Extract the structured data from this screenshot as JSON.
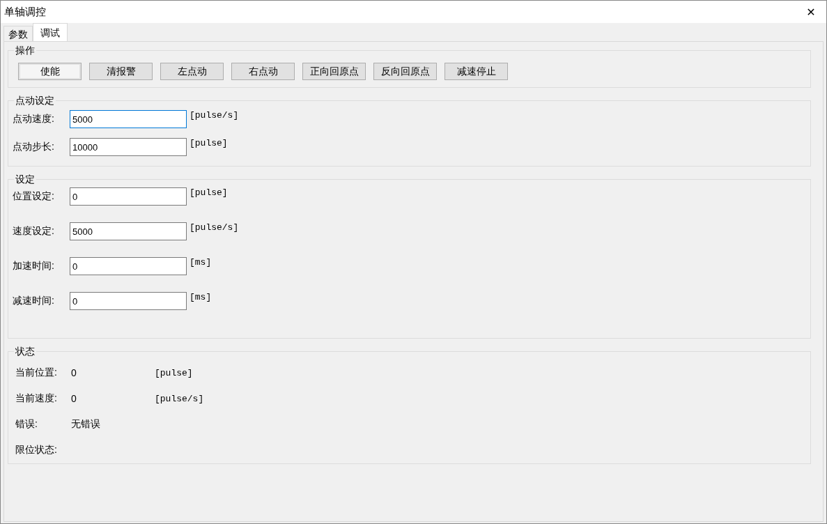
{
  "window": {
    "title": "单轴调控",
    "close": "✕"
  },
  "tabs": [
    {
      "label": "参数",
      "selected": false
    },
    {
      "label": "调试",
      "selected": true
    }
  ],
  "operation": {
    "title": "操作",
    "buttons": [
      {
        "label": "使能",
        "default": true
      },
      {
        "label": "清报警",
        "default": false
      },
      {
        "label": "左点动",
        "default": false
      },
      {
        "label": "右点动",
        "default": false
      },
      {
        "label": "正向回原点",
        "default": false
      },
      {
        "label": "反向回原点",
        "default": false
      },
      {
        "label": "减速停止",
        "default": false
      }
    ]
  },
  "jog_settings": {
    "title": "点动设定",
    "fields": [
      {
        "label": "点动速度:",
        "value": "5000",
        "unit": "[pulse/s]",
        "focused": true
      },
      {
        "label": "点动步长:",
        "value": "10000",
        "unit": "[pulse]",
        "focused": false
      }
    ]
  },
  "settings": {
    "title": "设定",
    "fields": [
      {
        "label": "位置设定:",
        "value": "0",
        "unit": "[pulse]",
        "focused": false
      },
      {
        "label": "速度设定:",
        "value": "5000",
        "unit": "[pulse/s]",
        "focused": false
      },
      {
        "label": "加速时间:",
        "value": "0",
        "unit": "[ms]",
        "focused": false
      },
      {
        "label": "减速时间:",
        "value": "0",
        "unit": "[ms]",
        "focused": false
      }
    ]
  },
  "status": {
    "title": "状态",
    "rows": [
      {
        "label": "当前位置:",
        "value": "0",
        "unit": "[pulse]"
      },
      {
        "label": "当前速度:",
        "value": "0",
        "unit": "[pulse/s]"
      },
      {
        "label": "错误:",
        "value": "无错误"
      },
      {
        "label": "限位状态:"
      }
    ]
  }
}
